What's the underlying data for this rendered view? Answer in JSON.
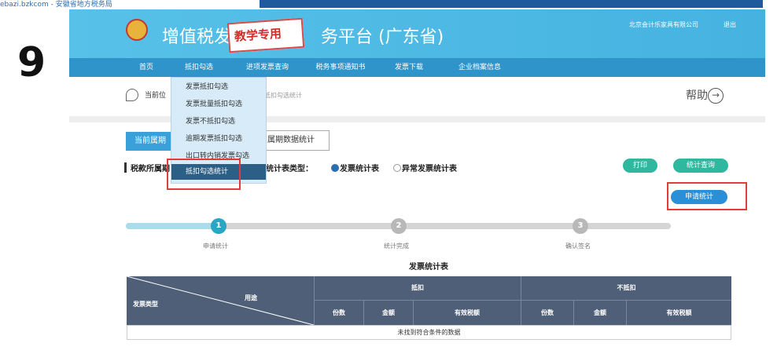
{
  "top": {
    "source_text": "ebazi.bzkcom - 安徽省地方税务局"
  },
  "page_number": "9",
  "header": {
    "title_left": "增值税发",
    "stamp_text": "教学专用",
    "title_right": "务平台 (广东省)",
    "company": "北京会计乐家具有限公司",
    "logout": "退出"
  },
  "nav": {
    "items": [
      "首页",
      "抵扣勾选",
      "进项发票查询",
      "税务事项通知书",
      "发票下载",
      "企业档案信息"
    ]
  },
  "dropdown": {
    "items": [
      "发票抵扣勾选",
      "发票批量抵扣勾选",
      "发票不抵扣勾选",
      "逾期发票抵扣勾选",
      "出口转内销发票勾选",
      "抵扣勾选统计"
    ]
  },
  "breadcrumb": {
    "label": "当前位",
    "rest": "抵扣勾选统计"
  },
  "help": {
    "label": "帮助"
  },
  "tabs": {
    "current": "当前属期",
    "past": "属期数据统计"
  },
  "section": {
    "title": "税款所属期",
    "type_label": "统计表类型：",
    "options": [
      "发票统计表",
      "异常发票统计表"
    ]
  },
  "buttons": {
    "print": "打印",
    "stat_query": "统计查询",
    "apply_stat": "申请统计"
  },
  "steps": {
    "numbers": [
      "1",
      "2",
      "3"
    ],
    "labels": [
      "申请统计",
      "统计完成",
      "确认签名"
    ],
    "progress": 0.16
  },
  "table": {
    "title": "发票统计表",
    "corner_type": "发票类型",
    "corner_use": "用途",
    "groups": [
      "抵扣",
      "不抵扣"
    ],
    "subheaders": [
      "份数",
      "金额",
      "有效税额",
      "份数",
      "金额",
      "有效税额"
    ],
    "empty_text": "未找到符合条件的数据"
  },
  "colors": {
    "header": "#4fb9e4",
    "nav": "#2e94c9",
    "table_head": "#4f5f78",
    "teal": "#2fb7a0",
    "highlight": "#e23b3b"
  }
}
